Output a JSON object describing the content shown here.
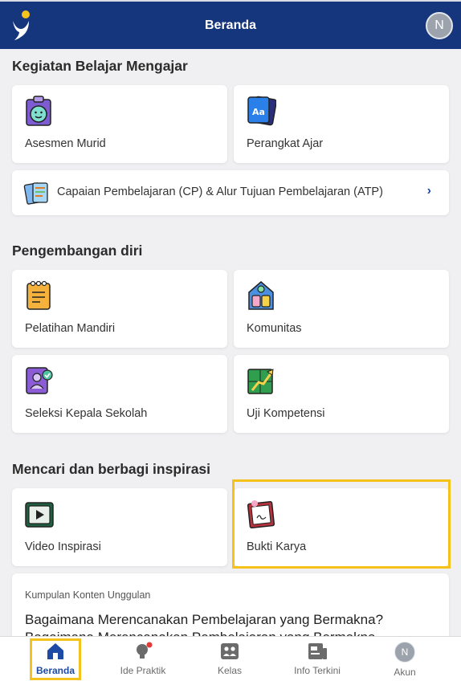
{
  "header": {
    "title": "Beranda",
    "avatar_initial": "N"
  },
  "sections": {
    "kbm": {
      "title": "Kegiatan Belajar Mengajar",
      "asesmen": "Asesmen Murid",
      "perangkat": "Perangkat Ajar",
      "cp_atp": "Capaian Pembelajaran (CP) & Alur Tujuan Pembelajaran (ATP)"
    },
    "pengembangan": {
      "title": "Pengembangan diri",
      "pelatihan": "Pelatihan Mandiri",
      "komunitas": "Komunitas",
      "seleksi": "Seleksi Kepala Sekolah",
      "uji": "Uji Kompetensi"
    },
    "inspirasi": {
      "title": "Mencari dan berbagi inspirasi",
      "video": "Video Inspirasi",
      "bukti": "Bukti Karya"
    }
  },
  "featured": {
    "kicker": "Kumpulan Konten Unggulan",
    "title": "Bagaimana Merencanakan Pembelajaran yang Bermakna?",
    "title_second_line": "Bagaimana Merencanakan Pembelajaran yang Bermakna"
  },
  "bottom_nav": {
    "beranda": "Beranda",
    "ide_praktik": "Ide Praktik",
    "kelas": "Kelas",
    "info_terkini": "Info Terkini",
    "akun": "Akun",
    "akun_initial": "N"
  },
  "colors": {
    "header": "#15357c",
    "accent": "#1c4aa5",
    "highlight": "#f5c21b"
  }
}
